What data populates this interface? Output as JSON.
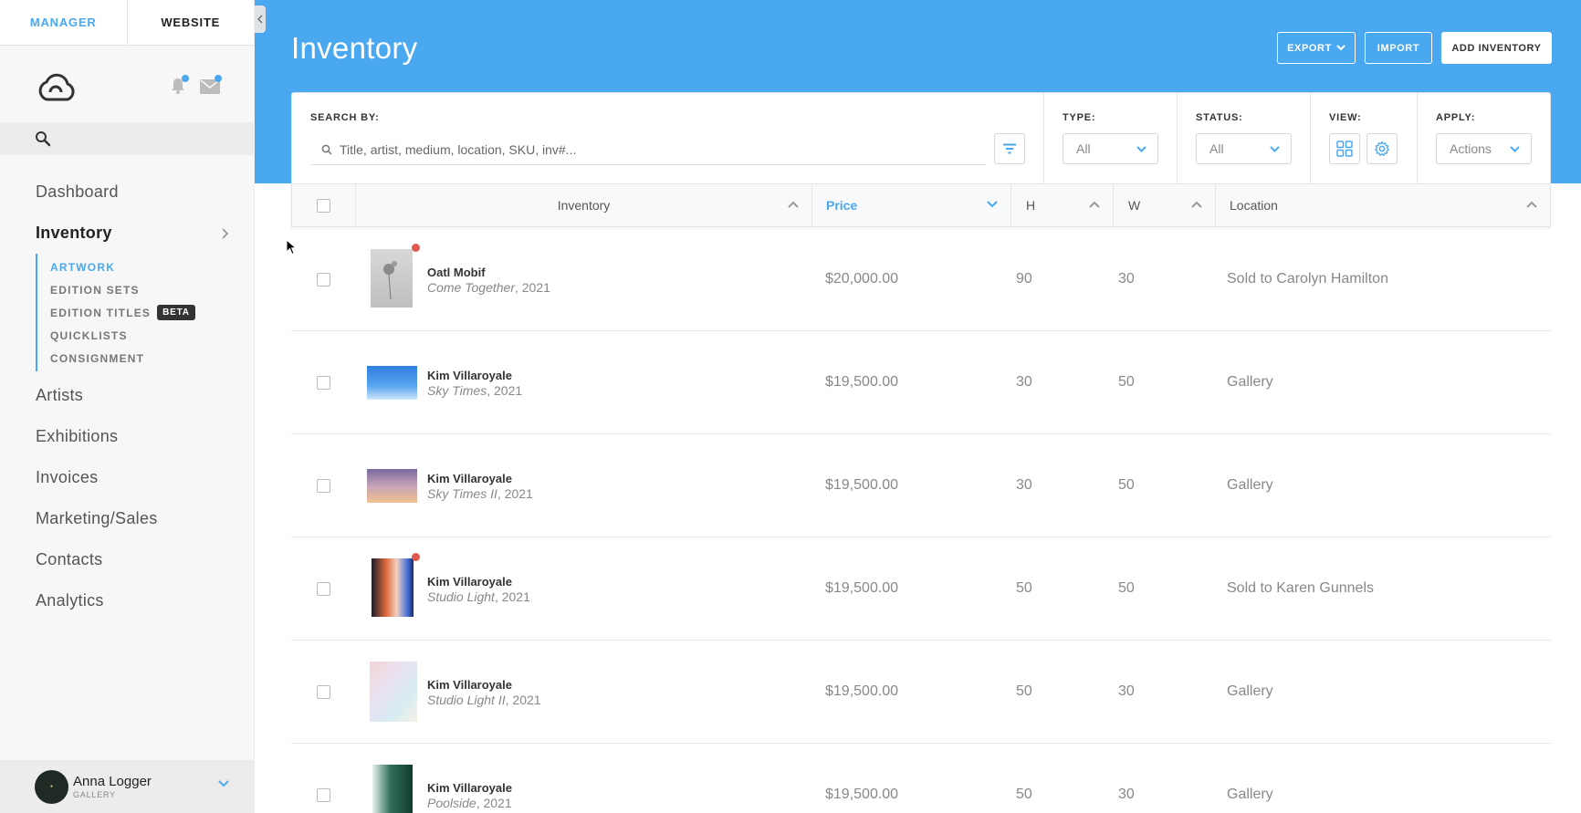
{
  "tabs": {
    "manager": "MANAGER",
    "website": "WEBSITE"
  },
  "sidebar": {
    "nav": [
      {
        "label": "Dashboard"
      },
      {
        "label": "Inventory"
      },
      {
        "label": "Artists"
      },
      {
        "label": "Exhibitions"
      },
      {
        "label": "Invoices"
      },
      {
        "label": "Marketing/Sales"
      },
      {
        "label": "Contacts"
      },
      {
        "label": "Analytics"
      }
    ],
    "inventory_sub": [
      {
        "label": "ARTWORK"
      },
      {
        "label": "EDITION SETS"
      },
      {
        "label": "EDITION TITLES",
        "badge": "BETA"
      },
      {
        "label": "QUICKLISTS"
      },
      {
        "label": "CONSIGNMENT"
      }
    ]
  },
  "user": {
    "name": "Anna Logger",
    "role": "GALLERY"
  },
  "header": {
    "title": "Inventory",
    "export_label": "EXPORT",
    "import_label": "IMPORT",
    "add_label": "ADD INVENTORY"
  },
  "filters": {
    "search_label": "SEARCH BY:",
    "search_placeholder": "Title, artist, medium, location, SKU, inv#...",
    "type_label": "TYPE:",
    "type_value": "All",
    "status_label": "STATUS:",
    "status_value": "All",
    "view_label": "VIEW:",
    "apply_label": "APPLY:",
    "apply_value": "Actions"
  },
  "table": {
    "columns": {
      "inventory": "Inventory",
      "price": "Price",
      "h": "H",
      "w": "W",
      "location": "Location"
    },
    "rows": [
      {
        "artist": "Oatl Mobif",
        "title": "Come Together",
        "year": ", 2021",
        "price": "$20,000.00",
        "h": "90",
        "w": "30",
        "location": "Sold to Carolyn Hamilton",
        "sold": true
      },
      {
        "artist": "Kim Villaroyale",
        "title": "Sky Times",
        "year": ", 2021",
        "price": "$19,500.00",
        "h": "30",
        "w": "50",
        "location": "Gallery",
        "sold": false
      },
      {
        "artist": "Kim Villaroyale",
        "title": "Sky Times II",
        "year": ", 2021",
        "price": "$19,500.00",
        "h": "30",
        "w": "50",
        "location": "Gallery",
        "sold": false
      },
      {
        "artist": "Kim Villaroyale",
        "title": "Studio Light",
        "year": ", 2021",
        "price": "$19,500.00",
        "h": "50",
        "w": "50",
        "location": "Sold to Karen Gunnels",
        "sold": true
      },
      {
        "artist": "Kim Villaroyale",
        "title": "Studio Light II",
        "year": ", 2021",
        "price": "$19,500.00",
        "h": "50",
        "w": "30",
        "location": "Gallery",
        "sold": false
      },
      {
        "artist": "Kim Villaroyale",
        "title": "Poolside",
        "year": ", 2021",
        "price": "$19,500.00",
        "h": "50",
        "w": "30",
        "location": "Gallery",
        "sold": false
      }
    ]
  },
  "colors": {
    "accent": "#4aa8f0",
    "sold_dot": "#e05a4f"
  }
}
